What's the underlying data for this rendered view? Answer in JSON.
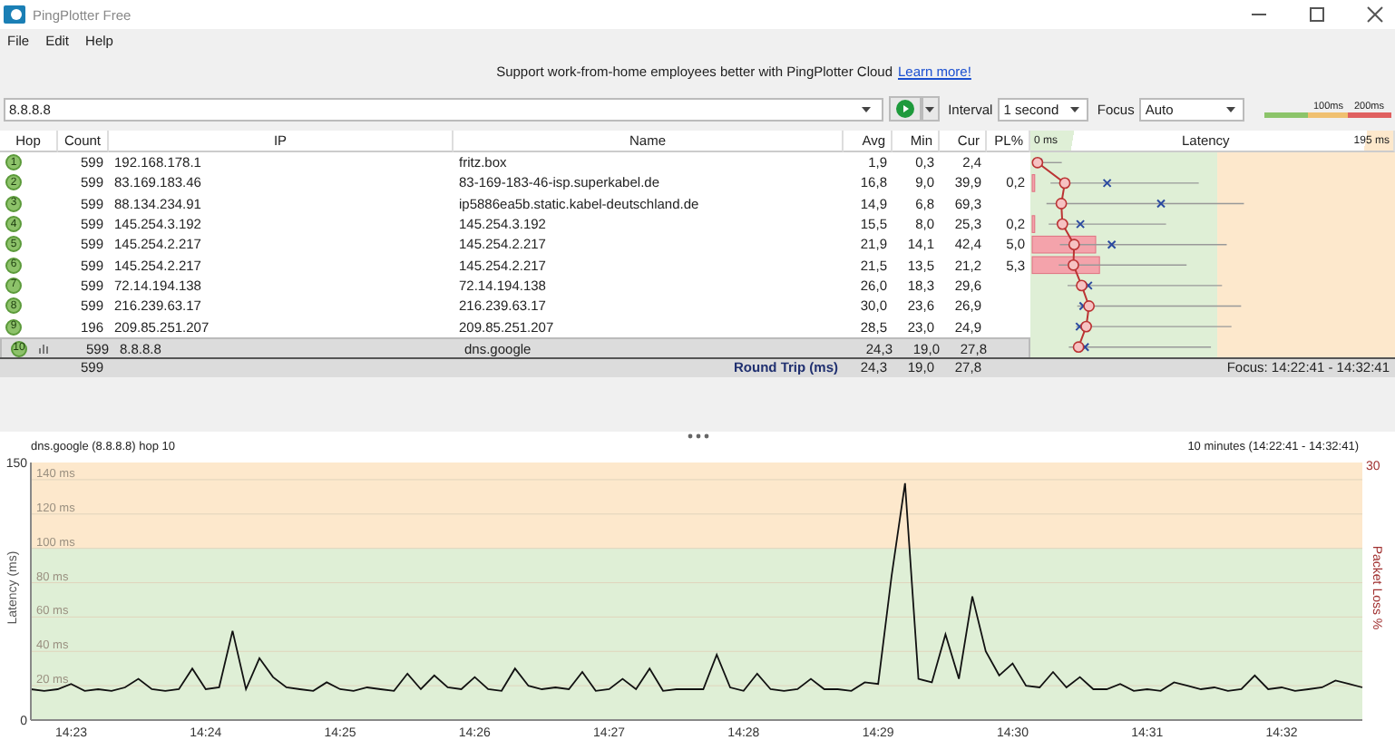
{
  "window": {
    "title": "PingPlotter Free"
  },
  "menu": [
    {
      "label": "File"
    },
    {
      "label": "Edit"
    },
    {
      "label": "Help"
    }
  ],
  "banner": {
    "text": "Support work-from-home employees better with PingPlotter Cloud",
    "link": "Learn more!"
  },
  "toolbar": {
    "target": "8.8.8.8",
    "interval_label": "Interval",
    "interval": "1 second",
    "focus_label": "Focus",
    "focus": "Auto",
    "legend": [
      "100ms",
      "200ms"
    ]
  },
  "table": {
    "columns": [
      "Hop",
      "Count",
      "IP",
      "Name",
      "Avg",
      "Min",
      "Cur",
      "PL%",
      "Latency"
    ],
    "latency_scale": [
      "0 ms",
      "195 ms"
    ],
    "rows": [
      {
        "hop": "1",
        "count": "599",
        "ip": "192.168.178.1",
        "name": "fritz.box",
        "avg": "1,9",
        "min": "0,3",
        "cur": "2,4",
        "selected": false
      },
      {
        "hop": "2",
        "count": "599",
        "ip": "83.169.183.46",
        "name": "83-169-183-46-isp.superkabel.de",
        "avg": "16,8",
        "min": "9,0",
        "cur": "39,9",
        "pl": "0,2",
        "selected": false
      },
      {
        "hop": "3",
        "count": "599",
        "ip": "88.134.234.91",
        "name": "ip5886ea5b.static.kabel-deutschland.de",
        "avg": "14,9",
        "min": "6,8",
        "cur": "69,3",
        "selected": false
      },
      {
        "hop": "4",
        "count": "599",
        "ip": "145.254.3.192",
        "name": "145.254.3.192",
        "avg": "15,5",
        "min": "8,0",
        "cur": "25,3",
        "pl": "0,2",
        "selected": false
      },
      {
        "hop": "5",
        "count": "599",
        "ip": "145.254.2.217",
        "name": "145.254.2.217",
        "avg": "21,9",
        "min": "14,1",
        "cur": "42,4",
        "pl": "5,0",
        "selected": false
      },
      {
        "hop": "6",
        "count": "599",
        "ip": "145.254.2.217",
        "name": "145.254.2.217",
        "avg": "21,5",
        "min": "13,5",
        "cur": "21,2",
        "pl": "5,3",
        "selected": false
      },
      {
        "hop": "7",
        "count": "599",
        "ip": "72.14.194.138",
        "name": "72.14.194.138",
        "avg": "26,0",
        "min": "18,3",
        "cur": "29,6",
        "selected": false
      },
      {
        "hop": "8",
        "count": "599",
        "ip": "216.239.63.17",
        "name": "216.239.63.17",
        "avg": "30,0",
        "min": "23,6",
        "cur": "26,9",
        "selected": false
      },
      {
        "hop": "9",
        "count": "196",
        "ip": "209.85.251.207",
        "name": "209.85.251.207",
        "avg": "28,5",
        "min": "23,0",
        "cur": "24,9",
        "selected": false
      },
      {
        "hop": "10",
        "count": "599",
        "ip": "8.8.8.8",
        "name": "dns.google",
        "avg": "24,3",
        "min": "19,0",
        "cur": "27,8",
        "selected": true
      }
    ],
    "summary": {
      "count": "599",
      "label": "Round Trip (ms)",
      "avg": "24,3",
      "min": "19,0",
      "cur": "27,8",
      "focus": "Focus: 14:22:41 - 14:32:41"
    }
  },
  "chart": {
    "title": "dns.google (8.8.8.8) hop 10",
    "range": "10 minutes (14:22:41 - 14:32:41)",
    "packet_loss_axis": {
      "label": "Packet Loss %",
      "max": "30"
    },
    "latency_axis": {
      "min": "0",
      "max": "150"
    },
    "chart_data": {
      "type": "line",
      "ylabel": "Latency (ms)",
      "ylim": [
        0,
        150
      ],
      "yticks": [
        {
          "value": 20,
          "label": "20 ms"
        },
        {
          "value": 40,
          "label": "40 ms"
        },
        {
          "value": 60,
          "label": "60 ms"
        },
        {
          "value": 80,
          "label": "80 ms"
        },
        {
          "value": 100,
          "label": "100 ms"
        },
        {
          "value": 120,
          "label": "120 ms"
        },
        {
          "value": 140,
          "label": "140 ms"
        }
      ],
      "grid": true,
      "bands": [
        {
          "axis": "y",
          "from": 100,
          "to": 150,
          "color": "#fde8cc"
        },
        {
          "axis": "y",
          "from": 0,
          "to": 100,
          "color": "#dfefd6"
        }
      ],
      "categories": [
        null,
        null,
        null,
        "14:23",
        null,
        null,
        null,
        null,
        null,
        null,
        null,
        null,
        null,
        "14:24",
        null,
        null,
        null,
        null,
        null,
        null,
        null,
        null,
        null,
        "14:25",
        null,
        null,
        null,
        null,
        null,
        null,
        null,
        null,
        null,
        "14:26",
        null,
        null,
        null,
        null,
        null,
        null,
        null,
        null,
        null,
        "14:27",
        null,
        null,
        null,
        null,
        null,
        null,
        null,
        null,
        null,
        "14:28",
        null,
        null,
        null,
        null,
        null,
        null,
        null,
        null,
        null,
        "14:29",
        null,
        null,
        null,
        null,
        null,
        null,
        null,
        null,
        null,
        "14:30",
        null,
        null,
        null,
        null,
        null,
        null,
        null,
        null,
        null,
        "14:31",
        null,
        null,
        null,
        null,
        null,
        null,
        null,
        null,
        null,
        "14:32",
        null,
        null,
        null,
        null,
        null,
        null
      ],
      "series": [
        {
          "color": "#111111",
          "values": [
            18,
            17,
            18,
            21,
            17,
            18,
            17,
            19,
            24,
            18,
            17,
            18,
            30,
            18,
            19,
            52,
            18,
            36,
            25,
            19,
            18,
            17,
            22,
            18,
            17,
            19,
            18,
            17,
            27,
            18,
            26,
            19,
            18,
            25,
            18,
            17,
            30,
            20,
            18,
            19,
            18,
            28,
            17,
            18,
            24,
            18,
            30,
            17,
            18,
            18,
            18,
            38,
            19,
            17,
            27,
            18,
            17,
            18,
            24,
            18,
            18,
            17,
            22,
            21,
            84,
            138,
            24,
            22,
            50,
            24,
            72,
            40,
            26,
            33,
            20,
            19,
            28,
            19,
            25,
            18,
            18,
            21,
            17,
            18,
            17,
            22,
            20,
            18,
            19,
            17,
            18,
            26,
            18,
            19,
            17,
            18,
            19,
            23,
            21,
            19
          ]
        }
      ]
    }
  }
}
